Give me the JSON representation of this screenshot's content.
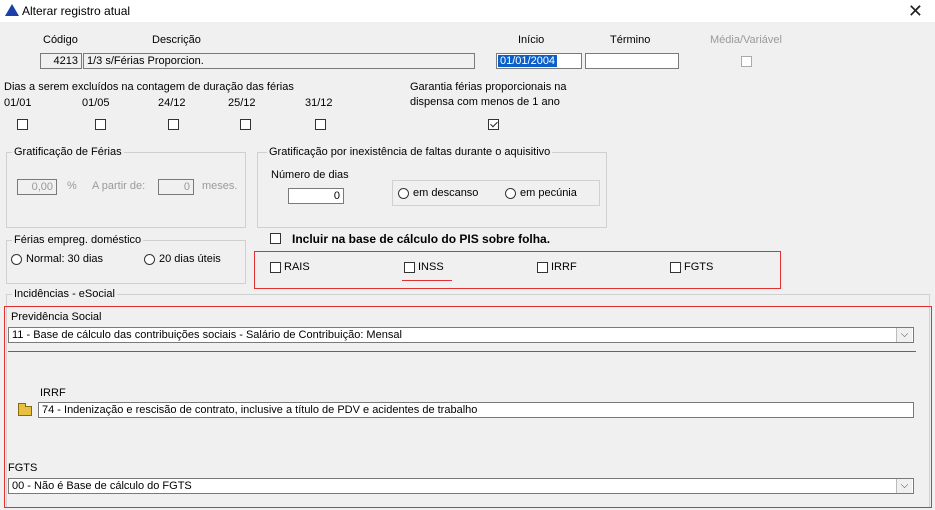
{
  "window": {
    "title": "Alterar registro atual",
    "close_symbol": "✕"
  },
  "header": {
    "codigo_label": "Código",
    "descricao_label": "Descrição",
    "inicio_label": "Início",
    "termino_label": "Término",
    "media_label": "Média/Variável",
    "codigo_value": "4213",
    "descricao_value": "1/3 s/Férias Proporcion.",
    "inicio_value": "01/01/2004",
    "termino_value": ""
  },
  "dias_excluidos": {
    "label": "Dias a serem excluídos na contagem de duração das férias",
    "dates": [
      "01/01",
      "01/05",
      "24/12",
      "25/12",
      "31/12"
    ]
  },
  "garantia": {
    "label_line1": "Garantia férias proporcionais na",
    "label_line2": "dispensa com menos de 1 ano"
  },
  "gratificacao_ferias": {
    "title": "Gratificação de Férias",
    "percent_value": "0,00",
    "percent_symbol": "%",
    "a_partir_label": "A partir de:",
    "meses_value": "0",
    "meses_label": "meses."
  },
  "gratificacao_faltas": {
    "title": "Gratificação por inexistência de faltas durante o aquisitivo",
    "numero_dias_label": "Número de dias",
    "numero_dias_value": "0",
    "radio_descanso": "em descanso",
    "radio_pecunia": "em pecúnia"
  },
  "ferias_domestico": {
    "title": "Férias empreg. doméstico",
    "radio_normal": "Normal: 30 dias",
    "radio_uteis": "20 dias úteis"
  },
  "pis": {
    "label": "Incluir na base de cálculo do PIS sobre folha."
  },
  "incidencias": {
    "rais": "RAIS",
    "inss": "INSS",
    "irrf": "IRRF",
    "fgts": "FGTS"
  },
  "esocial": {
    "title": "Incidências - eSocial",
    "previdencia_label": "Previdência Social",
    "previdencia_value": "11 - Base de cálculo das contribuições sociais - Salário de Contribuição: Mensal",
    "irrf_label": "IRRF",
    "irrf_value": "74 - Indenização e rescisão de contrato, inclusive a título de PDV e acidentes de trabalho",
    "fgts_label": "FGTS",
    "fgts_value": "00 - Não é Base de cálculo do FGTS"
  },
  "colors": {
    "accent_red": "#e03030",
    "selection_blue": "#0a60c8"
  }
}
